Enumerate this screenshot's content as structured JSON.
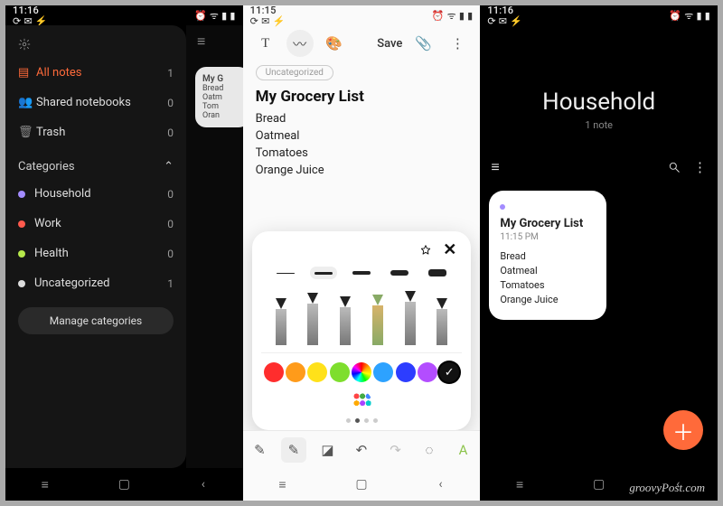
{
  "watermark": "groovyPost.com",
  "phone1": {
    "status_time": "11:16",
    "drawer": {
      "sections": {
        "all_notes": {
          "label": "All notes",
          "count": "1"
        },
        "shared": {
          "label": "Shared notebooks",
          "count": "0"
        },
        "trash": {
          "label": "Trash",
          "count": "0"
        }
      },
      "categories_header": "Categories",
      "categories": [
        {
          "label": "Household",
          "count": "0",
          "color": "#a38cff"
        },
        {
          "label": "Work",
          "count": "0",
          "color": "#ff5a4d"
        },
        {
          "label": "Health",
          "count": "0",
          "color": "#b6e84b"
        },
        {
          "label": "Uncategorized",
          "count": "1",
          "color": "#dddddd"
        }
      ],
      "manage_label": "Manage categories"
    },
    "under_card": {
      "title": "My G",
      "lines": [
        "Bread",
        "Oatm",
        "Tom",
        "Oran"
      ]
    }
  },
  "phone2": {
    "status_time": "11:15",
    "toolbar": {
      "save_label": "Save"
    },
    "chip_label": "Uncategorized",
    "doc_title": "My Grocery List",
    "doc_body": [
      "Bread",
      "Oatmeal",
      "Tomatoes",
      "Orange Juice"
    ],
    "palette": {
      "colors_row1": [
        "#ff2d2d",
        "#ff9b1a",
        "#ffe11a",
        "#7ede2d"
      ],
      "colors_row2": [
        "#2da2ff",
        "#2d3dff",
        "#b34dff",
        "#111111"
      ]
    }
  },
  "phone3": {
    "status_time": "11:16",
    "header_title": "Household",
    "header_sub": "1 note",
    "card": {
      "title": "My Grocery List",
      "time": "11:15 PM",
      "body": [
        "Bread",
        "Oatmeal",
        "Tomatoes",
        "Orange Juice"
      ]
    }
  }
}
